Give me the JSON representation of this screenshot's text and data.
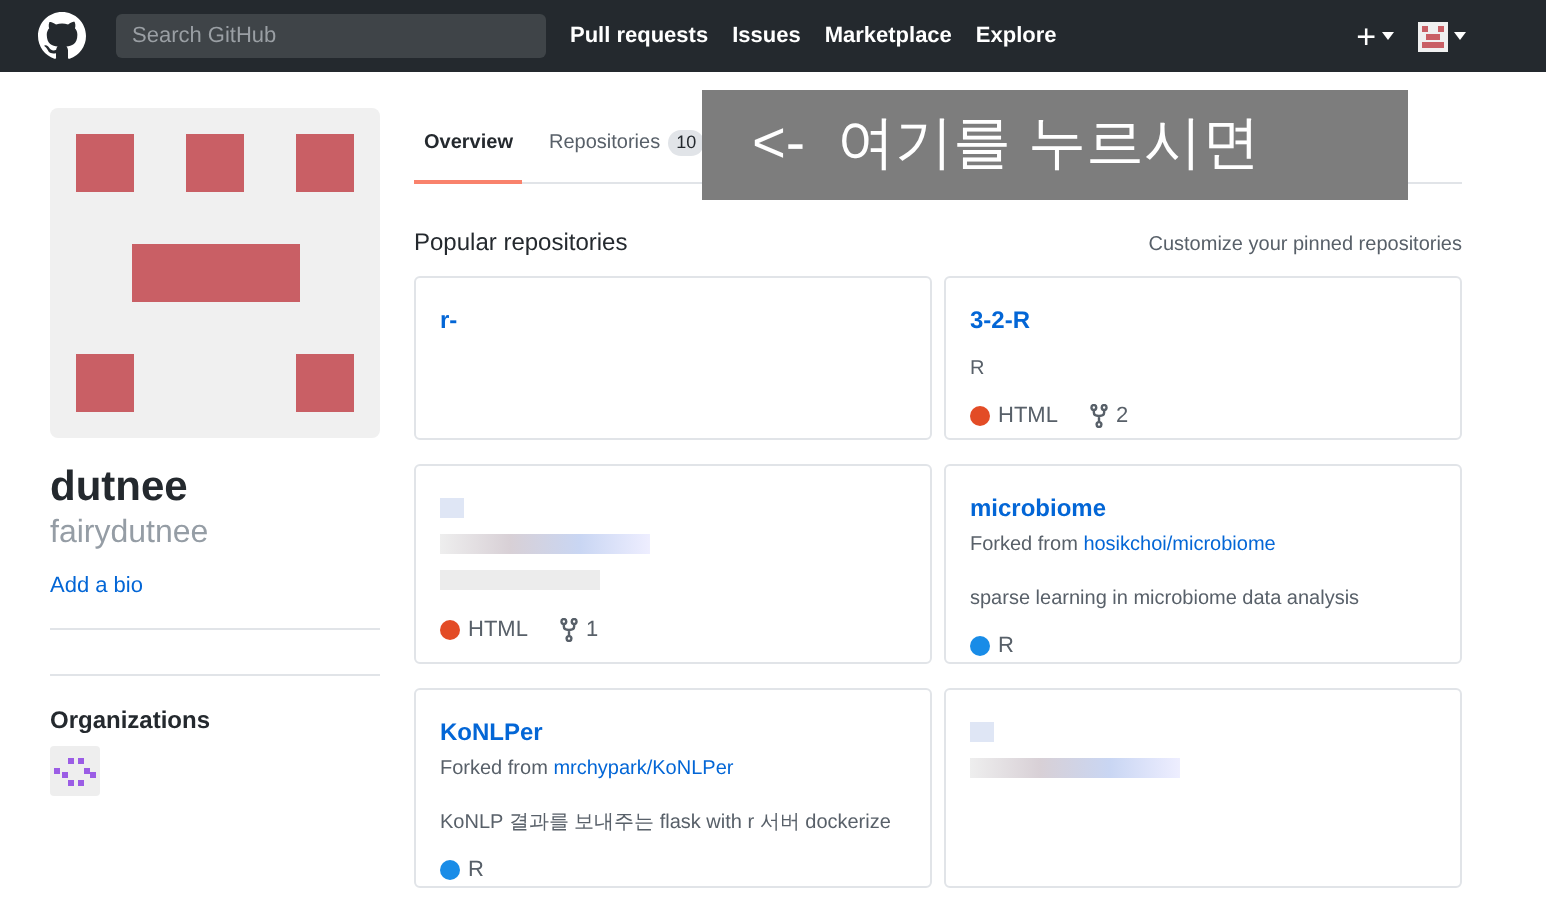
{
  "header": {
    "search": {
      "placeholder": "Search GitHub"
    },
    "nav": [
      "Pull requests",
      "Issues",
      "Marketplace",
      "Explore"
    ],
    "new_menu": "+"
  },
  "profile": {
    "name": "dutnee",
    "username": "fairydutnee",
    "bio_link": "Add a bio",
    "organizations_title": "Organizations"
  },
  "tabs": [
    {
      "label": "Overview",
      "selected": true
    },
    {
      "label": "Repositories",
      "count": "10",
      "selected": false
    }
  ],
  "overlay": {
    "text": "<-  여기를 누르시면"
  },
  "popular": {
    "title": "Popular repositories",
    "customize": "Customize your pinned repositories",
    "repos": [
      {
        "kind": "repo",
        "name": "r-"
      },
      {
        "kind": "repo",
        "name": "3-2-R",
        "description": "R",
        "language": "HTML",
        "color": "#e34c26",
        "forks": "2"
      },
      {
        "kind": "redacted",
        "language": "HTML",
        "color": "#e34c26",
        "forks": "1"
      },
      {
        "kind": "repo",
        "name": "microbiome",
        "forked_prefix": "Forked from",
        "forked_source": "hosikchoi/microbiome",
        "description": "sparse learning in microbiome data analysis",
        "language": "R",
        "color": "#198ce7"
      },
      {
        "kind": "repo",
        "name": "KoNLPer",
        "forked_prefix": "Forked from",
        "forked_source": "mrchypark/KoNLPer",
        "description": "KoNLP 결과를 보내주는 flask with r 서버 dockerize",
        "language": "R",
        "color": "#198ce7"
      },
      {
        "kind": "redacted"
      }
    ]
  }
}
